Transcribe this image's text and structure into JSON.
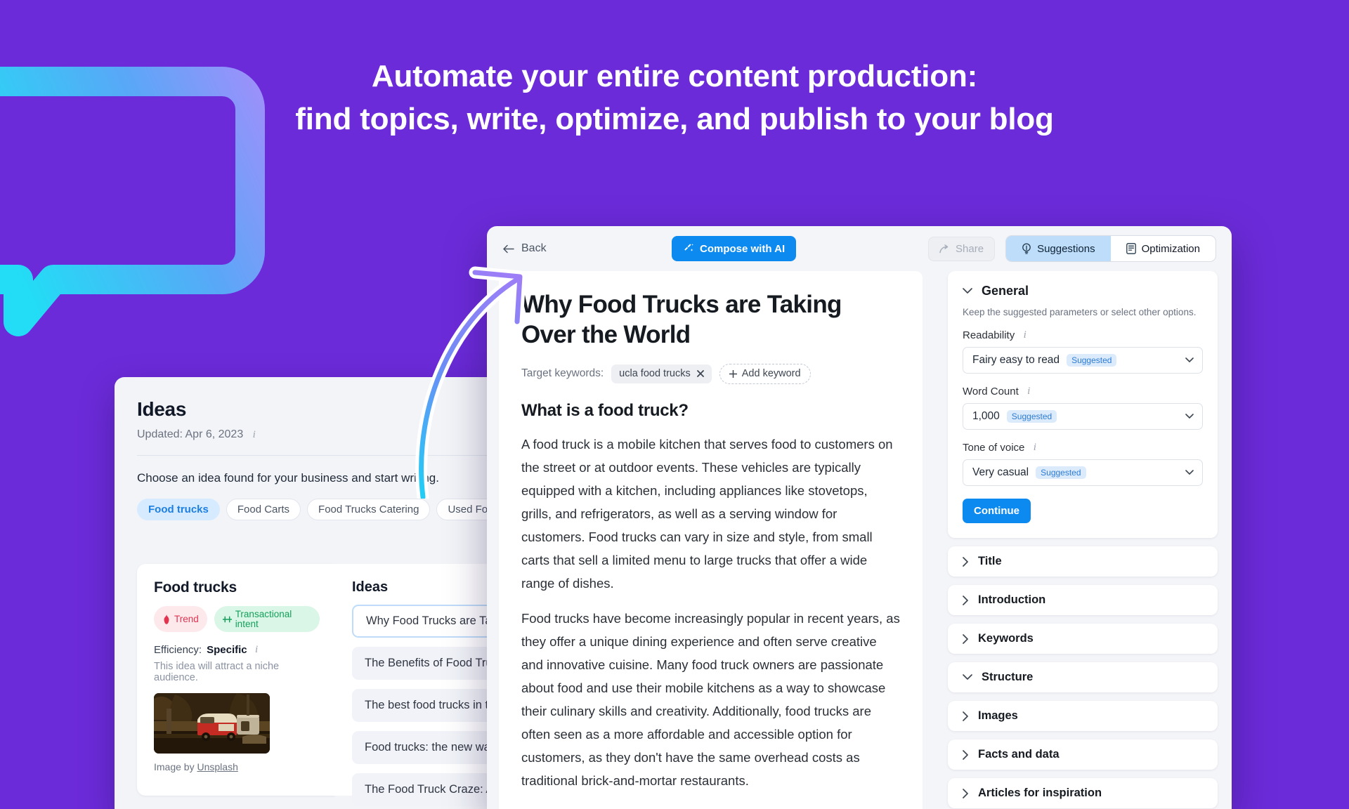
{
  "theme": {
    "background_purple": "#6C2BD9",
    "accent_blue": "#0D8AF0",
    "bubble_gradient_from": "#22DDF5",
    "bubble_gradient_to": "#9B7CFA",
    "badge_trend_color": "#E0344F",
    "badge_intent_color": "#15A05B"
  },
  "headline": {
    "line1": "Automate your entire content production:",
    "line2": "find topics, write, optimize, and publish to your blog"
  },
  "ideas_window": {
    "title": "Ideas",
    "updated": "Updated: Apr 6, 2023",
    "subtitle": "Choose an idea found for your business and start writing.",
    "tags": [
      {
        "label": "Food trucks",
        "active": true
      },
      {
        "label": "Food Carts",
        "active": false
      },
      {
        "label": "Food Trucks Catering",
        "active": false
      },
      {
        "label": "Used Food Truck For Sale",
        "active": false
      }
    ],
    "idea_card": {
      "title": "Food trucks",
      "badges": [
        {
          "label": "Trend",
          "icon": "flame-icon"
        },
        {
          "label": "Transactional intent",
          "icon": "intent-icon"
        }
      ],
      "efficiency_label": "Efficiency:",
      "efficiency_value": "Specific",
      "efficiency_desc": "This idea will attract a niche audience.",
      "image_caption_prefix": "Image by ",
      "image_caption_link": "Unsplash"
    },
    "ideas_list": {
      "heading": "Ideas",
      "items": [
        {
          "label": "Why Food Trucks are Taking Over the World",
          "selected": true
        },
        {
          "label": "The Benefits of Food Trucks for Local Economies",
          "selected": false
        },
        {
          "label": "The best food trucks in town: a guide",
          "selected": false
        },
        {
          "label": "Food trucks: the new wave of dining out",
          "selected": false
        },
        {
          "label": "The Food Truck Craze: A Look at the Trend",
          "selected": false
        }
      ]
    }
  },
  "editor": {
    "toolbar": {
      "back_label": "Back",
      "back_icon": "arrow-left-icon",
      "compose_label": "Compose with AI",
      "compose_icon": "magic-wand-icon",
      "share_label": "Share",
      "share_icon": "share-arrow-icon",
      "tabs": [
        {
          "label": "Suggestions",
          "icon": "lightbulb-icon",
          "active": true
        },
        {
          "label": "Optimization",
          "icon": "document-icon",
          "active": false
        }
      ]
    },
    "document": {
      "title": "Why Food Trucks are Taking Over the World",
      "keywords_label": "Target keywords:",
      "keyword_chip": "ucla food trucks",
      "keyword_chip_remove_icon": "close-icon",
      "add_keyword_label": "Add keyword",
      "add_keyword_icon": "plus-icon",
      "heading2": "What is a food truck?",
      "paragraphs": [
        "A food truck is a mobile kitchen that serves food to customers on the street or at outdoor events. These vehicles are typically equipped with a kitchen, including appliances like stovetops, grills, and refrigerators, as well as a serving window for customers. Food trucks can vary in size and style, from small carts that sell a limited menu to large trucks that offer a wide range of dishes.",
        "Food trucks have become increasingly popular in recent years, as they offer a unique dining experience and often serve creative and innovative cuisine. Many food truck owners are passionate about food and use their mobile kitchens as a way to showcase their culinary skills and creativity. Additionally, food trucks are often seen as a more affordable and accessible option for customers, as they don't have the same overhead costs as traditional brick-and-mortar restaurants."
      ]
    },
    "sidebar": {
      "general": {
        "title": "General",
        "chevron_icon": "chevron-down-icon",
        "description": "Keep the suggested parameters or select other options.",
        "fields": [
          {
            "label": "Readability",
            "value": "Fairy easy to read",
            "badge": "Suggested",
            "info_icon": "info-icon",
            "chevron_icon": "chevron-down-icon"
          },
          {
            "label": "Word Count",
            "value": "1,000",
            "badge": "Suggested",
            "info_icon": "info-icon",
            "chevron_icon": "chevron-down-icon"
          },
          {
            "label": "Tone of voice",
            "value": "Very casual",
            "badge": "Suggested",
            "info_icon": "info-icon",
            "chevron_icon": "chevron-down-icon"
          }
        ],
        "continue_label": "Continue"
      },
      "sections": [
        {
          "label": "Title",
          "expanded": false,
          "icon": "chevron-right-icon"
        },
        {
          "label": "Introduction",
          "expanded": false,
          "icon": "chevron-right-icon"
        },
        {
          "label": "Keywords",
          "expanded": false,
          "icon": "chevron-right-icon"
        },
        {
          "label": "Structure",
          "expanded": true,
          "icon": "chevron-down-icon"
        },
        {
          "label": "Images",
          "expanded": false,
          "icon": "chevron-right-icon"
        },
        {
          "label": "Facts and data",
          "expanded": false,
          "icon": "chevron-right-icon"
        },
        {
          "label": "Articles for inspiration",
          "expanded": false,
          "icon": "chevron-right-icon"
        }
      ]
    }
  }
}
